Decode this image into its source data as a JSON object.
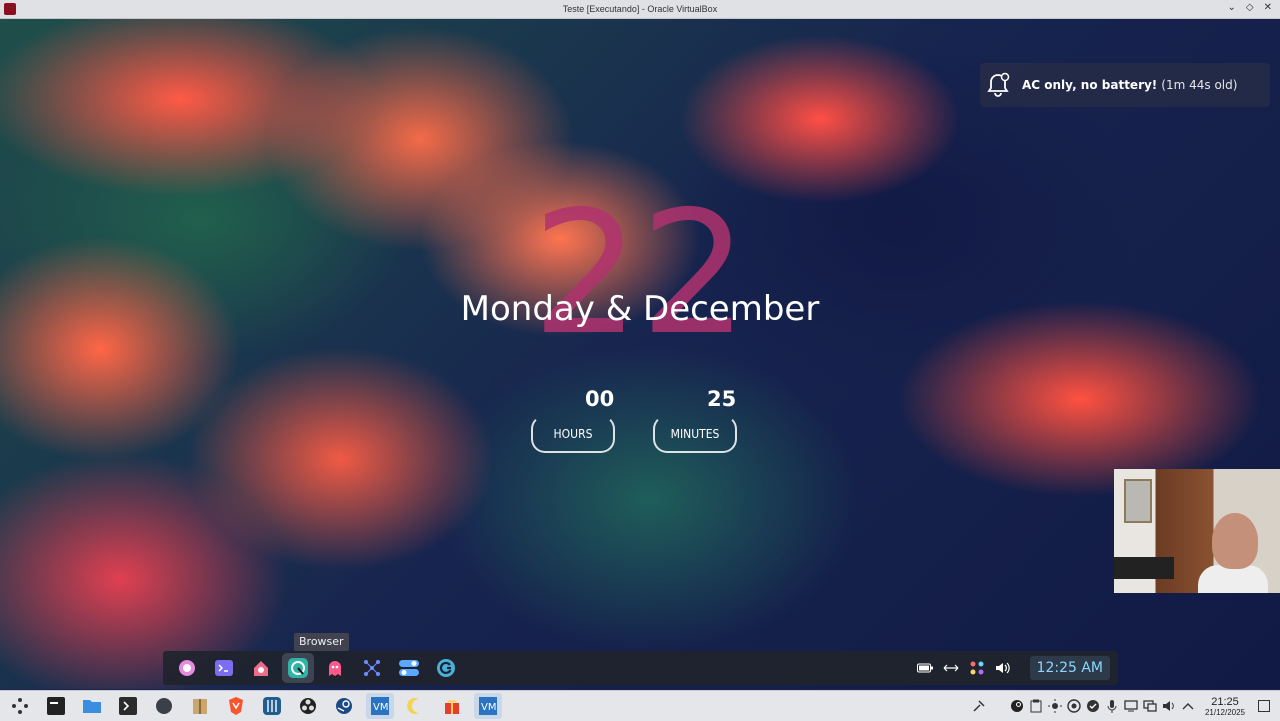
{
  "window": {
    "title": "Teste [Executando] - Oracle VirtualBox",
    "controls": [
      "⌄",
      "◇",
      "✕"
    ]
  },
  "desktop": {
    "day_number": "22",
    "date_line": "Monday & December",
    "hours": {
      "value": "00",
      "label": "HOURS"
    },
    "minutes": {
      "value": "25",
      "label": "MINUTES"
    }
  },
  "notification": {
    "title": "AC only, no battery!",
    "age": "(1m 44s old)",
    "icon": "bell-icon"
  },
  "tooltip": "Browser",
  "dock": {
    "items": [
      {
        "name": "launcher-icon",
        "color": "#e58be0"
      },
      {
        "name": "terminal-icon",
        "color": "#7b6cf0"
      },
      {
        "name": "home-icon",
        "color": "#f06a8a"
      },
      {
        "name": "browser-icon",
        "color": "#2fb5a8",
        "active": true
      },
      {
        "name": "ghost-icon",
        "color": "#ff5a8a"
      },
      {
        "name": "network-icon",
        "color": "#6e8cff"
      },
      {
        "name": "toggles-icon",
        "color": "#5aa8ff"
      },
      {
        "name": "refresh-app-icon",
        "color": "#4ab0d8"
      }
    ],
    "tray": [
      "battery-icon",
      "arrows-icon",
      "palette-icon",
      "volume-icon"
    ],
    "clock": "12:25 AM"
  },
  "host_taskbar": {
    "apps": [
      "app-menu-icon",
      "terminal-app-icon",
      "files-icon",
      "console-icon",
      "record-icon",
      "archive-icon",
      "brave-icon",
      "mixer-icon",
      "obs-icon",
      "steam-icon",
      "virtualbox-icon",
      "moon-app-icon",
      "gift-icon",
      "virtualbox-icon-2"
    ],
    "tray": [
      "tools-icon",
      "night-icon",
      "steam-tray-icon",
      "clipboard-icon",
      "brightness-icon",
      "chrome-icon",
      "updates-icon",
      "mic-icon",
      "display-icon",
      "network-tray-icon",
      "speaker-icon",
      "chevron-up-icon"
    ],
    "time": "21:25",
    "date": "21/12/2025"
  }
}
